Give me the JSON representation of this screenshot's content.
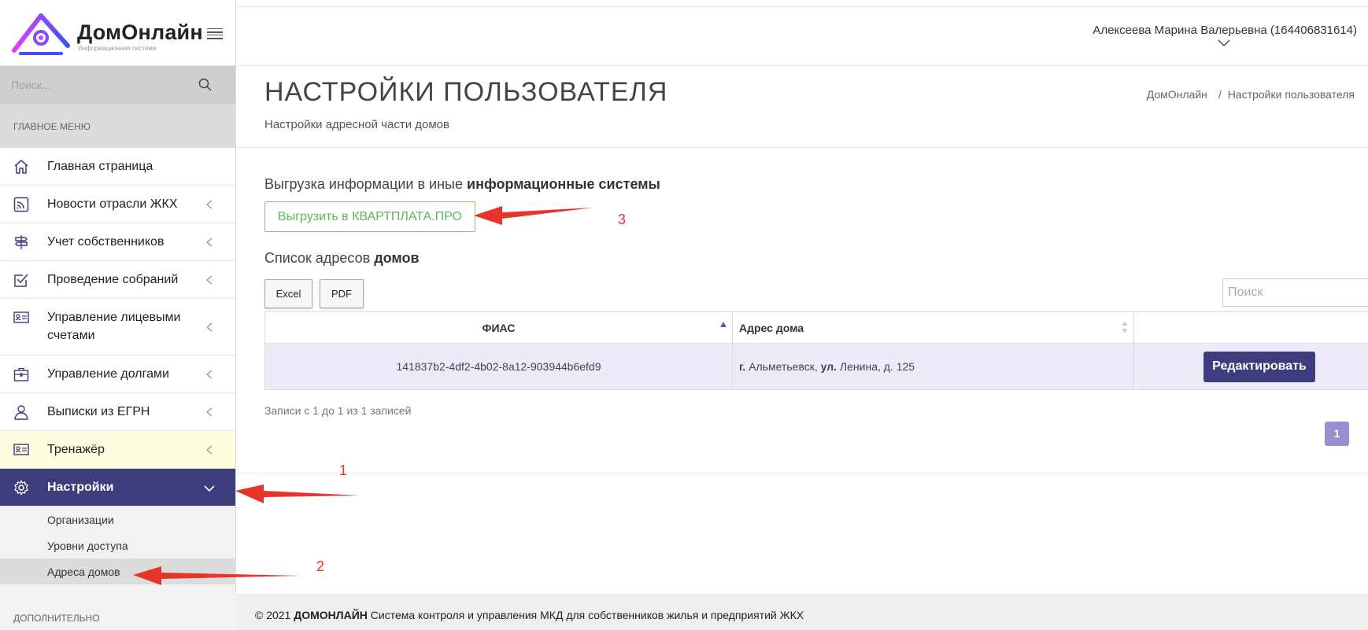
{
  "app": {
    "logo_name": "ДомОнлайн",
    "logo_subtitle": "Информационная система"
  },
  "search": {
    "placeholder": "Поиск..."
  },
  "menu": {
    "header": "ГЛАВНОЕ МЕНЮ",
    "items": [
      {
        "label": "Главная страница",
        "icon": "home-icon"
      },
      {
        "label": "Новости отрасли ЖКХ",
        "icon": "rss-icon"
      },
      {
        "label": "Учет собственников",
        "icon": "signpost-icon"
      },
      {
        "label": "Проведение собраний",
        "icon": "checkbox-icon"
      },
      {
        "label": "Управление лицевыми счетами",
        "icon": "id-card-icon"
      },
      {
        "label": "Управление долгами",
        "icon": "briefcase-icon"
      },
      {
        "label": "Выписки из ЕГРН",
        "icon": "user-icon"
      },
      {
        "label": "Тренажёр",
        "icon": "id-card-icon"
      },
      {
        "label": "Настройки",
        "icon": "gear-icon"
      }
    ],
    "submenu": [
      "Организации",
      "Уровни доступа",
      "Адреса домов"
    ],
    "extra_header": "ДОПОЛНИТЕЛЬНО"
  },
  "user": {
    "name": "Алексеева Марина Валерьевна (164406831614)"
  },
  "page": {
    "title": "НАСТРОЙКИ ПОЛЬЗОВАТЕЛЯ",
    "subtitle": "Настройки адресной части домов",
    "breadcrumb": [
      "ДомОнлайн",
      "/",
      "Настройки пользователя"
    ]
  },
  "export_section": {
    "title_plain": "Выгрузка информации в иные ",
    "title_bold": "информационные системы",
    "button": "Выгрузить в КВАРТПЛАТА.ПРО"
  },
  "list_section": {
    "title_plain": "Список адресов ",
    "title_bold": "домов",
    "buttons": [
      "Excel",
      "PDF"
    ],
    "search_placeholder": "Поиск"
  },
  "table": {
    "headers": [
      "ФИАС",
      "Адрес дома",
      ""
    ],
    "rows": [
      {
        "fias": "141837b2-4df2-4b02-8a12-903944b6efd9",
        "addr_city_prefix": "г.",
        "addr_city": " Альметьевск, ",
        "addr_street_prefix": "ул.",
        "addr_street": " Ленина, д. 125",
        "action": "Редактировать"
      }
    ]
  },
  "pagination": {
    "info": "Записи с 1 до 1 из 1 записей",
    "current": "1"
  },
  "annotations": [
    "1",
    "2",
    "3"
  ],
  "footer": {
    "copyright": "© 2021 ",
    "brand": "ДОМОНЛАЙН",
    "text": " Система контроля и управления МКД для собственников жилья и предприятий ЖКХ"
  },
  "colors": {
    "accent": "#3d3d7d",
    "export_green": "#5bb85b",
    "annotation_red": "#e33",
    "page_badge": "#9a8fd0"
  }
}
